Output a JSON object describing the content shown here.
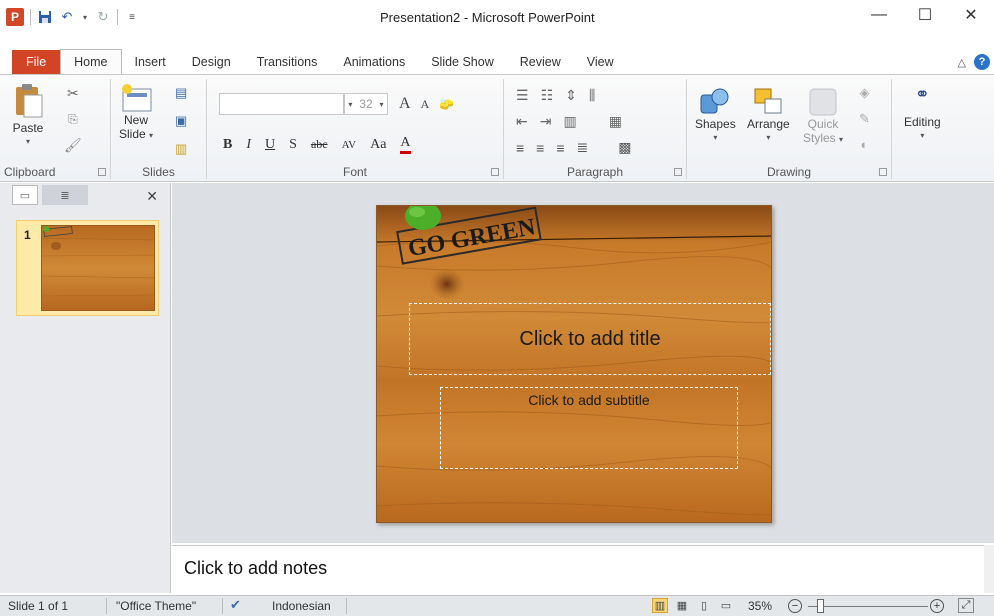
{
  "window": {
    "title": "Presentation2 - Microsoft PowerPoint",
    "logo_letter": "P",
    "minimize": "—",
    "maximize": "☐",
    "close": "✕"
  },
  "tabs": [
    "File",
    "Home",
    "Insert",
    "Design",
    "Transitions",
    "Animations",
    "Slide Show",
    "Review",
    "View"
  ],
  "active_tab": "Home",
  "ribbon": {
    "clipboard": {
      "label": "Clipboard",
      "paste": "Paste"
    },
    "slides": {
      "label": "Slides",
      "new_slide_line1": "New",
      "new_slide_line2": "Slide"
    },
    "font": {
      "label": "Font",
      "font_size": "32",
      "grow": "A",
      "shrink": "A",
      "bold": "B",
      "italic": "I",
      "underline": "U",
      "shadow": "S",
      "strike": "abc",
      "spacing": "AV",
      "case": "Aa",
      "color": "A"
    },
    "paragraph": {
      "label": "Paragraph"
    },
    "drawing": {
      "label": "Drawing",
      "shapes": "Shapes",
      "arrange": "Arrange",
      "quick_styles_1": "Quick",
      "quick_styles_2": "Styles"
    },
    "editing": {
      "label": "Editing"
    }
  },
  "panel": {
    "slide_number": "1",
    "close": "✕"
  },
  "slide": {
    "stamp_text": "GO GREEN",
    "title_placeholder": "Click to add title",
    "subtitle_placeholder": "Click to add subtitle",
    "colors": {
      "wood": "#c9802f",
      "wood_dark": "#9a5a1e",
      "leaf": "#4caf2a"
    }
  },
  "notes": {
    "placeholder": "Click to add notes"
  },
  "status": {
    "slide_info": "Slide 1 of 1",
    "theme": "\"Office Theme\"",
    "language": "Indonesian",
    "zoom": "35%"
  },
  "colors": {
    "file_tab": "#d14424",
    "accent": "#2a73c9"
  }
}
